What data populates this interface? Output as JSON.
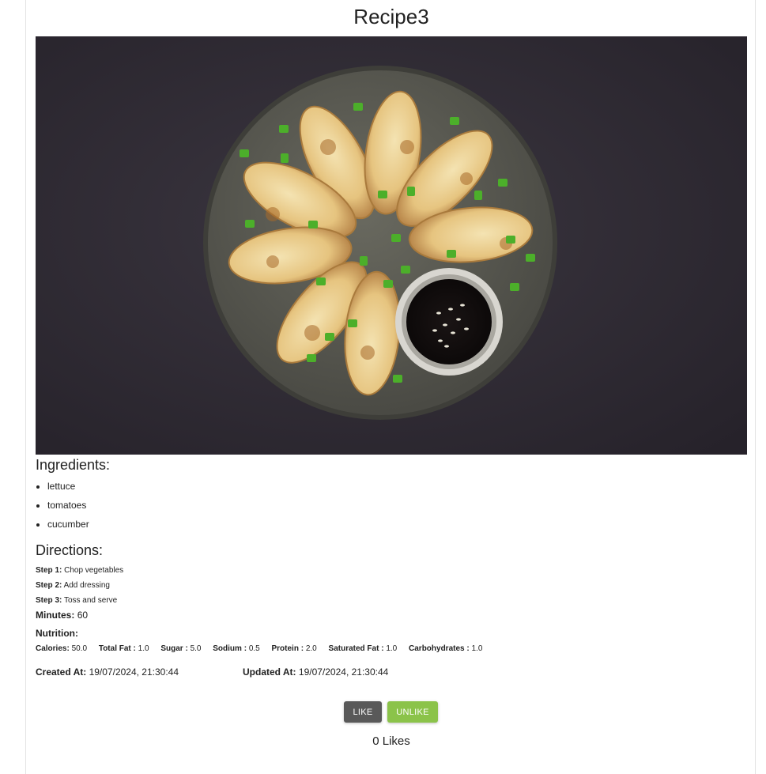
{
  "recipe": {
    "title": "Recipe3",
    "image_alt": "dumplings with soy sauce and green onions on a plate"
  },
  "ingredients": {
    "heading": "Ingredients:",
    "items": [
      "lettuce",
      "tomatoes",
      "cucumber"
    ]
  },
  "directions": {
    "heading": "Directions:",
    "steps": [
      {
        "label": "Step 1:",
        "text": "Chop vegetables"
      },
      {
        "label": "Step 2:",
        "text": "Add dressing"
      },
      {
        "label": "Step 3:",
        "text": "Toss and serve"
      }
    ]
  },
  "minutes": {
    "label": "Minutes:",
    "value": "60"
  },
  "nutrition": {
    "heading": "Nutrition:",
    "items": [
      {
        "label": "Calories:",
        "value": "50.0"
      },
      {
        "label": "Total Fat :",
        "value": "1.0"
      },
      {
        "label": "Sugar :",
        "value": "5.0"
      },
      {
        "label": "Sodium :",
        "value": "0.5"
      },
      {
        "label": "Protein :",
        "value": "2.0"
      },
      {
        "label": "Saturated Fat :",
        "value": "1.0"
      },
      {
        "label": "Carbohydrates :",
        "value": "1.0"
      }
    ]
  },
  "dates": {
    "created_label": "Created At:",
    "created_value": "19/07/2024, 21:30:44",
    "updated_label": "Updated At:",
    "updated_value": "19/07/2024, 21:30:44"
  },
  "actions": {
    "like_label": "LIKE",
    "unlike_label": "UNLIKE",
    "likes_text": "0 Likes"
  },
  "colors": {
    "like_button": "#595959",
    "unlike_button": "#8bc34a",
    "photo_background": "#2f2b33"
  }
}
